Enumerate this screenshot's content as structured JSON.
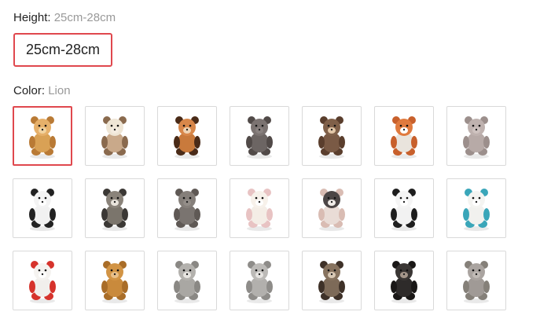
{
  "height": {
    "label": "Height: ",
    "value": "25cm-28cm",
    "options": [
      "25cm-28cm"
    ],
    "selected": "25cm-28cm"
  },
  "color": {
    "label": "Color: ",
    "value": "Lion",
    "selected": "Lion",
    "swatches": [
      {
        "icon": "lion-plush",
        "body": "#d9a155",
        "head": "#e6b06a",
        "accent": "#b97a35",
        "face": "#f2d3a0"
      },
      {
        "icon": "giraffe-plush",
        "body": "#c9a98a",
        "head": "#efe6d6",
        "accent": "#8a6a4e",
        "face": "#f4ece0"
      },
      {
        "icon": "tiger-plush",
        "body": "#c97a3c",
        "head": "#d8874a",
        "accent": "#4a2b18",
        "face": "#f0d4b4"
      },
      {
        "icon": "elephant-plush",
        "body": "#6c6563",
        "head": "#7b7371",
        "accent": "#514a48",
        "face": "#8a8280"
      },
      {
        "icon": "monkey-plush",
        "body": "#7a5a45",
        "head": "#806049",
        "accent": "#5a3e2d",
        "face": "#e3c7a8"
      },
      {
        "icon": "fox-plush",
        "body": "#e9e4dd",
        "head": "#e07a3e",
        "accent": "#c8602c",
        "face": "#ffffff"
      },
      {
        "icon": "hippo-plush",
        "body": "#b7aaa7",
        "head": "#bfb2af",
        "accent": "#9c8f8c",
        "face": "#cfc3c0"
      },
      {
        "icon": "zebra-plush",
        "body": "#f1f1f1",
        "head": "#f3f3f3",
        "accent": "#222222",
        "face": "#ffffff"
      },
      {
        "icon": "raccoon-plush",
        "body": "#7b756c",
        "head": "#8a837a",
        "accent": "#3b3835",
        "face": "#e9e4dc"
      },
      {
        "icon": "rhino-plush",
        "body": "#7a7470",
        "head": "#857f7a",
        "accent": "#5f5955",
        "face": "#938d88"
      },
      {
        "icon": "rabbit-plush",
        "body": "#f4ede6",
        "head": "#f7f1ea",
        "accent": "#e8c3c3",
        "face": "#ffffff"
      },
      {
        "icon": "sheep-plush",
        "body": "#e9dcd6",
        "head": "#4c4646",
        "accent": "#d9bcb3",
        "face": "#f0ece8"
      },
      {
        "icon": "panda-plush",
        "body": "#f2f2f2",
        "head": "#f5f5f5",
        "accent": "#1e1e1e",
        "face": "#ffffff"
      },
      {
        "icon": "polar-bear-scarf-plush",
        "body": "#f1f1ee",
        "head": "#f4f4f1",
        "accent": "#3aa6b9",
        "face": "#ffffff"
      },
      {
        "icon": "polar-bear-red-scarf-plush",
        "body": "#f1efec",
        "head": "#f5f3f0",
        "accent": "#d6332c",
        "face": "#ffffff"
      },
      {
        "icon": "bear-plush",
        "body": "#c98a3c",
        "head": "#d29445",
        "accent": "#a96d28",
        "face": "#e9c08a"
      },
      {
        "icon": "cat-plush",
        "body": "#a9a7a3",
        "head": "#b3b1ad",
        "accent": "#8a8884",
        "face": "#e7e5e1"
      },
      {
        "icon": "dog-plush",
        "body": "#b2b0ad",
        "head": "#bcbab7",
        "accent": "#8e8c89",
        "face": "#e6e4e1"
      },
      {
        "icon": "wolf-plush",
        "body": "#7d6a58",
        "head": "#87735f",
        "accent": "#3e3128",
        "face": "#d9c9b5"
      },
      {
        "icon": "gorilla-plush",
        "body": "#2e2b2a",
        "head": "#3a3634",
        "accent": "#1a1817",
        "face": "#a5968a"
      },
      {
        "icon": "elephant-grey-plush",
        "body": "#a09a96",
        "head": "#aaa4a0",
        "accent": "#858079",
        "face": "#c1bbb6"
      }
    ]
  }
}
